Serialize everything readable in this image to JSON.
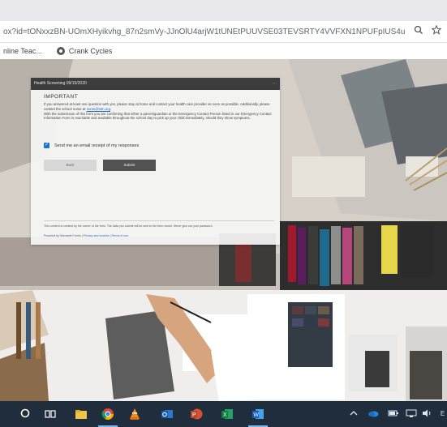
{
  "browser": {
    "url": "ox?id=tONxxzBN-UOmXHyikvhg_87n2smVy-JJnOlU4arjW1tUNEtPUUVSE03TEVSRTY4VVFXN1NPUFpIUS4u",
    "bookmarks": [
      {
        "label": "nline Teac...",
        "icon": "bookmark-globe-icon"
      },
      {
        "label": "Crank Cycles",
        "icon": "bookmark-globe-icon"
      }
    ],
    "icons": [
      "search-icon",
      "star-icon"
    ]
  },
  "form": {
    "header_title": "Health Screening 09/15/2020",
    "header_menu": "...",
    "important_title": "IMPORTANT",
    "body_line1": "If you answered at least one question with yes, please stay at home and contact your health care provider as soon as possible. Additionally, please contact the school nurse at ",
    "nurse_email": "nurse@stm.org",
    "body_line2": ".",
    "body_line3": "With the submission of this form you are confirming that either a parent/guardian or the Emergency Contact Person listed in our Emergency Contact Information Form is reachable and available throughout the school day to pick up your child immediately, should they show symptoms.",
    "checkbox_checked": true,
    "checkbox_label": "Send me an email receipt of my responses",
    "back_label": "Back",
    "submit_label": "Submit",
    "footer_text": "This content is created by the owner of the form. The data you submit will be sent to the form owner. Never give out your password.",
    "footer_powered": "Powered by Microsoft Forms | ",
    "footer_privacy": "Privacy and cookies",
    "footer_sep": " | ",
    "footer_terms": "Terms of use"
  },
  "taskbar": {
    "items": [
      "search-icon",
      "task-view-icon",
      "file-explorer-icon",
      "chrome-icon",
      "vlc-icon",
      "outlook-icon",
      "powerpoint-icon",
      "excel-icon",
      "word-icon"
    ],
    "tray": [
      "chevron-up-icon",
      "onedrive-icon",
      "battery-icon",
      "network-icon",
      "volume-icon"
    ],
    "tray_text": "E"
  },
  "colors": {
    "accent": "#1a73c8",
    "taskbar": "#1f2d3d",
    "form_header": "#3c3c3c",
    "submit_bg": "#525252"
  }
}
